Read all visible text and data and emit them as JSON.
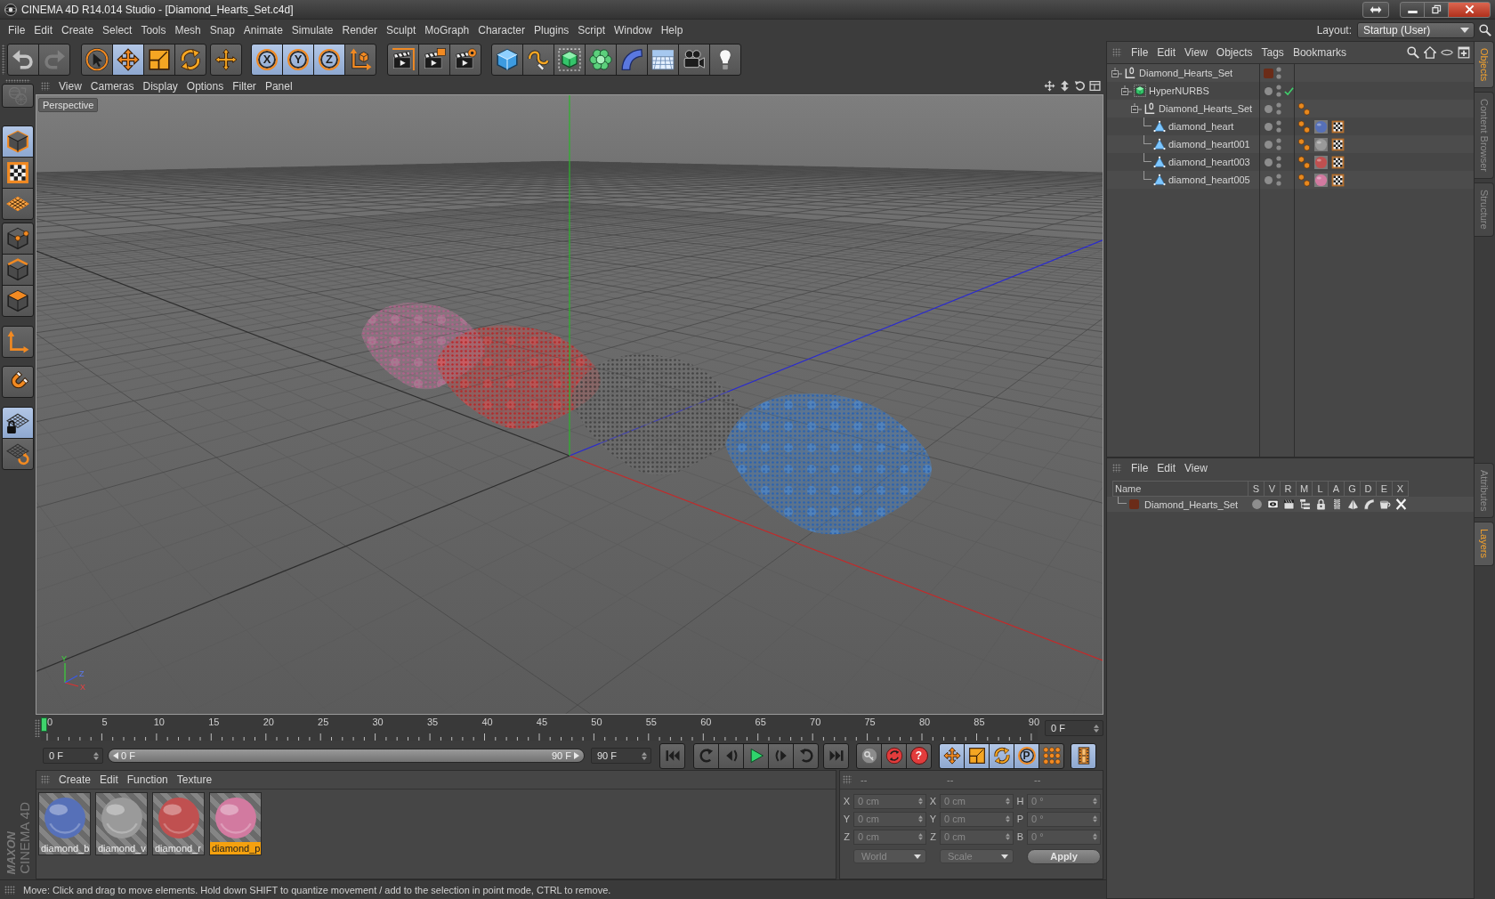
{
  "window": {
    "title": "CINEMA 4D R14.014 Studio - [Diamond_Hearts_Set.c4d]"
  },
  "menu_bar": {
    "items": [
      "File",
      "Edit",
      "Create",
      "Select",
      "Tools",
      "Mesh",
      "Snap",
      "Animate",
      "Simulate",
      "Render",
      "Sculpt",
      "MoGraph",
      "Character",
      "Plugins",
      "Script",
      "Window",
      "Help"
    ],
    "layout_label": "Layout:",
    "layout_value": "Startup (User)"
  },
  "toolbar": {
    "groups": [
      {
        "items": [
          {
            "kind": "undo",
            "disabled": false
          },
          {
            "kind": "redo",
            "disabled": true
          }
        ]
      },
      {
        "items": [
          {
            "kind": "live-select",
            "selected": false
          },
          {
            "kind": "move",
            "selected": true
          },
          {
            "kind": "scale",
            "selected": false
          },
          {
            "kind": "rotate",
            "selected": false
          }
        ]
      },
      {
        "items": [
          {
            "kind": "last-tool",
            "selected": false
          }
        ]
      },
      {
        "items": [
          {
            "kind": "axis-lock",
            "label": "X",
            "selected": true
          },
          {
            "kind": "axis-lock",
            "label": "Y",
            "selected": true
          },
          {
            "kind": "axis-lock",
            "label": "Z",
            "selected": true
          },
          {
            "kind": "coord-system",
            "selected": false
          }
        ]
      },
      {
        "items": [
          {
            "kind": "render-view"
          },
          {
            "kind": "render-picture"
          },
          {
            "kind": "render-settings"
          }
        ]
      },
      {
        "items": [
          {
            "kind": "cube"
          },
          {
            "kind": "spline"
          },
          {
            "kind": "nurbs"
          },
          {
            "kind": "array"
          },
          {
            "kind": "deformer"
          },
          {
            "kind": "scene"
          },
          {
            "kind": "camera"
          },
          {
            "kind": "light"
          }
        ]
      }
    ]
  },
  "left_toolbar": {
    "groups": [
      {
        "items": [
          {
            "kind": "make-editable",
            "disabled": true
          }
        ]
      },
      {
        "items": [
          {
            "kind": "model",
            "selected": true
          },
          {
            "kind": "texture",
            "selected": false
          },
          {
            "kind": "workplane",
            "selected": false
          }
        ]
      },
      {
        "items": [
          {
            "kind": "points",
            "selected": false
          },
          {
            "kind": "edges",
            "selected": false
          },
          {
            "kind": "polygons",
            "selected": false
          }
        ]
      },
      {
        "items": [
          {
            "kind": "axis",
            "selected": false
          }
        ]
      },
      {
        "items": [
          {
            "kind": "snap",
            "selected": false
          }
        ]
      },
      {
        "items": [
          {
            "kind": "lock-workplane",
            "selected": true
          },
          {
            "kind": "planar-workplane",
            "selected": false
          }
        ]
      }
    ]
  },
  "viewport": {
    "menu": [
      "View",
      "Cameras",
      "Display",
      "Options",
      "Filter",
      "Panel"
    ],
    "camera_label": "Perspective",
    "axis_labels": [
      "Y",
      "Z",
      "X"
    ]
  },
  "timeline": {
    "labels": [
      "0",
      "5",
      "10",
      "15",
      "20",
      "25",
      "30",
      "35",
      "40",
      "45",
      "50",
      "55",
      "60",
      "65",
      "70",
      "75",
      "80",
      "85",
      "90"
    ],
    "level": 0,
    "current_frame": "0 F"
  },
  "transport": {
    "start": "0 F",
    "range": {
      "start_label": "0 F",
      "end_label": "90 F",
      "level": 1
    },
    "end": "90 F",
    "groups": [
      {
        "items": [
          {
            "kind": "go-start"
          }
        ]
      },
      {
        "items": [
          {
            "kind": "prev-key"
          },
          {
            "kind": "prev-frame"
          },
          {
            "kind": "play"
          },
          {
            "kind": "next-frame"
          },
          {
            "kind": "next-key"
          }
        ]
      },
      {
        "items": [
          {
            "kind": "go-end"
          }
        ]
      },
      {
        "items": [
          {
            "kind": "record-active"
          },
          {
            "kind": "autokey"
          },
          {
            "kind": "keyframe-selection",
            "label": "?"
          }
        ]
      },
      {
        "items": [
          {
            "kind": "key-position",
            "selected": true
          },
          {
            "kind": "key-scale",
            "selected": true
          },
          {
            "kind": "key-rotation",
            "selected": true
          },
          {
            "kind": "key-parameter",
            "label": "P",
            "selected": true
          },
          {
            "kind": "key-point-level",
            "selected": false
          }
        ]
      },
      {
        "items": [
          {
            "kind": "timeline",
            "selected": true
          }
        ]
      }
    ]
  },
  "material_manager": {
    "menu": [
      "Create",
      "Edit",
      "Function",
      "Texture"
    ],
    "materials": [
      {
        "name": "diamond_b",
        "color": "#5670b8",
        "selected": false
      },
      {
        "name": "diamond_v",
        "color": "#9a9a9a",
        "selected": false
      },
      {
        "name": "diamond_r",
        "color": "#c05050",
        "selected": false
      },
      {
        "name": "diamond_p",
        "color": "#d27aa0",
        "selected": true
      }
    ]
  },
  "coordinates": {
    "headers": [
      "--",
      "--",
      "--"
    ],
    "rows": [
      [
        {
          "label": "X",
          "value": "0 cm"
        },
        {
          "label": "X",
          "value": "0 cm"
        },
        {
          "label": "H",
          "value": "0 °"
        }
      ],
      [
        {
          "label": "Y",
          "value": "0 cm"
        },
        {
          "label": "Y",
          "value": "0 cm"
        },
        {
          "label": "P",
          "value": "0 °"
        }
      ],
      [
        {
          "label": "Z",
          "value": "0 cm"
        },
        {
          "label": "Z",
          "value": "0 cm"
        },
        {
          "label": "B",
          "value": "0 °"
        }
      ]
    ],
    "space": "World",
    "mode": "Scale",
    "apply": "Apply"
  },
  "logo": {
    "brand": "MAXON",
    "product": "CINEMA 4D"
  },
  "status_bar": {
    "text": "Move: Click and drag to move elements. Hold down SHIFT to quantize movement / add to the selection in point mode, CTRL to remove."
  },
  "object_manager": {
    "menu": [
      "File",
      "Edit",
      "View",
      "Objects",
      "Tags",
      "Bookmarks"
    ],
    "objects": [
      {
        "name": "Diamond_Hearts_Set",
        "kind": "null",
        "layer": true,
        "expanded": true,
        "children": [
          {
            "name": "HyperNURBS",
            "kind": "hypernurbs",
            "layer": false,
            "enabled": true,
            "expanded": true,
            "children": [
              {
                "name": "Diamond_Hearts_Set",
                "kind": "null",
                "layer": false,
                "expanded": true,
                "tags": [
                  {
                    "kind": "phong"
                  }
                ],
                "children": [
                  {
                    "name": "diamond_heart",
                    "kind": "polygon",
                    "layer": false,
                    "tags": [
                      {
                        "kind": "phong"
                      },
                      {
                        "kind": "material",
                        "color": "#5670b8"
                      },
                      {
                        "kind": "uvw"
                      }
                    ]
                  },
                  {
                    "name": "diamond_heart001",
                    "kind": "polygon",
                    "layer": false,
                    "tags": [
                      {
                        "kind": "phong"
                      },
                      {
                        "kind": "material",
                        "color": "#9a9a9a"
                      },
                      {
                        "kind": "uvw"
                      }
                    ]
                  },
                  {
                    "name": "diamond_heart003",
                    "kind": "polygon",
                    "layer": false,
                    "tags": [
                      {
                        "kind": "phong"
                      },
                      {
                        "kind": "material",
                        "color": "#c05050"
                      },
                      {
                        "kind": "uvw"
                      }
                    ]
                  },
                  {
                    "name": "diamond_heart005",
                    "kind": "polygon",
                    "layer": false,
                    "tags": [
                      {
                        "kind": "phong"
                      },
                      {
                        "kind": "material",
                        "color": "#d27aa0"
                      },
                      {
                        "kind": "uvw"
                      }
                    ]
                  }
                ]
              }
            ]
          }
        ]
      }
    ]
  },
  "layer_manager": {
    "menu": [
      "File",
      "Edit",
      "View"
    ],
    "columns": [
      "Name",
      "S",
      "V",
      "R",
      "M",
      "L",
      "A",
      "G",
      "D",
      "E",
      "X"
    ],
    "layers": [
      {
        "name": "Diamond_Hearts_Set",
        "color": "#6b2c18",
        "switches": [
          {
            "kind": "solo"
          },
          {
            "kind": "view"
          },
          {
            "kind": "render"
          },
          {
            "kind": "manager"
          },
          {
            "kind": "lock"
          },
          {
            "kind": "animation"
          },
          {
            "kind": "generators"
          },
          {
            "kind": "deformers"
          },
          {
            "kind": "expressions"
          },
          {
            "kind": "xrefs"
          }
        ]
      }
    ]
  },
  "side_tabs": {
    "top": [
      {
        "label": "Objects",
        "selected": true
      },
      {
        "label": "Content Browser",
        "selected": false
      },
      {
        "label": "Structure",
        "selected": false
      }
    ],
    "bottom": [
      {
        "label": "Attributes",
        "selected": false
      },
      {
        "label": "Layers",
        "selected": true
      }
    ]
  }
}
